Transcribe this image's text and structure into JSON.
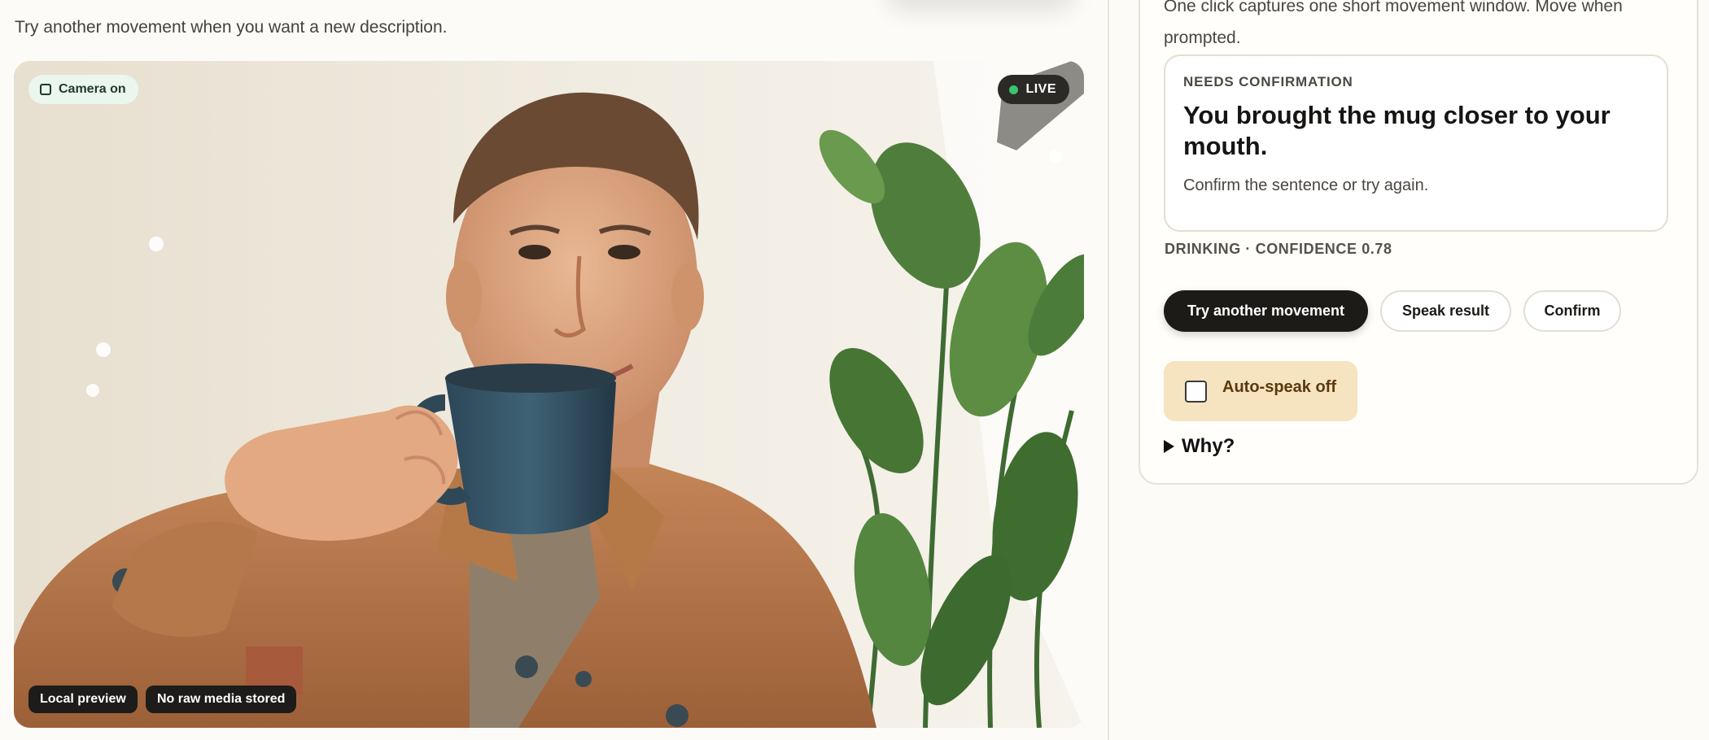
{
  "left": {
    "hint": "Try another movement when you want a new description.",
    "camera": {
      "status_label": "Camera on",
      "live_label": "LIVE",
      "chips": [
        "Local preview",
        "No raw media stored"
      ]
    }
  },
  "panel": {
    "intro": "One click captures one short movement window. Move when prompted.",
    "result": {
      "kicker": "NEEDS CONFIRMATION",
      "title": "You brought the mug closer to your mouth.",
      "subtitle": "Confirm the sentence or try again."
    },
    "meta": "DRINKING · CONFIDENCE 0.78",
    "buttons": {
      "try_again": "Try another movement",
      "speak": "Speak result",
      "confirm": "Confirm"
    },
    "auto_speak": {
      "label": "Auto-speak off",
      "checked": false
    },
    "why_label": "Why?"
  },
  "colors": {
    "accent_dark": "#1d1b18",
    "live_dot": "#3cc46e",
    "toggle_bg": "#f6e3bf",
    "camera_pill_bg": "#ebf6ee"
  },
  "icons": [
    "camera-square-icon",
    "live-dot-icon",
    "checkbox-icon",
    "disclosure-triangle-icon"
  ]
}
